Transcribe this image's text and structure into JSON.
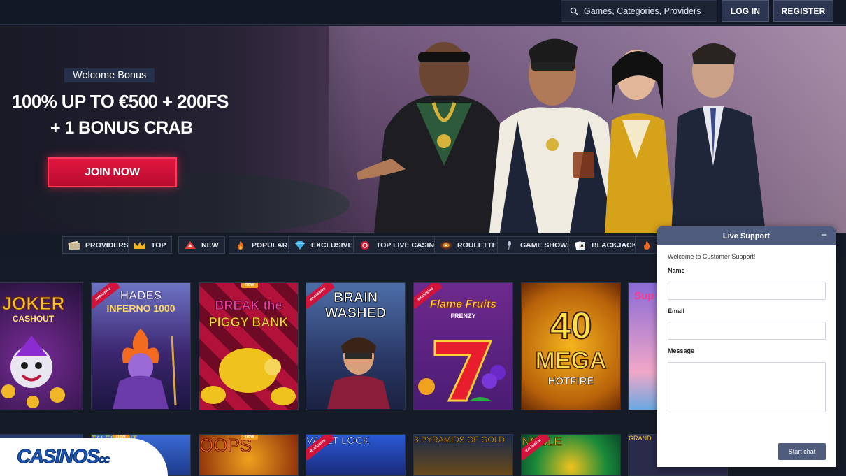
{
  "header": {
    "search_placeholder": "Games, Categories, Providers",
    "login_label": "LOG IN",
    "register_label": "REGISTER"
  },
  "hero": {
    "welcome_label": "Welcome Bonus",
    "promo_line1": "100% UP TO €500 + 200FS",
    "promo_line2": "+ 1 BONUS CRAB",
    "join_label": "JOIN NOW"
  },
  "categories": [
    {
      "label": "PROVIDERS",
      "icon": "cards-icon"
    },
    {
      "label": "TOP",
      "icon": "crown-icon"
    },
    {
      "label": "NEW",
      "icon": "new-badge-icon"
    },
    {
      "label": "POPULAR",
      "icon": "flame-icon"
    },
    {
      "label": "EXCLUSIVE",
      "icon": "diamond-icon"
    },
    {
      "label": "TOP LIVE CASINO",
      "icon": "chip-icon"
    },
    {
      "label": "ROULETTE",
      "icon": "roulette-icon"
    },
    {
      "label": "GAME SHOWS",
      "icon": "microphone-icon"
    },
    {
      "label": "BLACKJACK",
      "icon": "playing-cards-icon"
    }
  ],
  "games_row1": [
    {
      "title_a": "JOKER",
      "title_b": "CASHOUT",
      "badge": ""
    },
    {
      "title_a": "HADES",
      "title_b": "INFERNO 1000",
      "badge": "exclusive"
    },
    {
      "title_a": "BREAK the",
      "title_b": "PIGGY BANK",
      "badge": "new"
    },
    {
      "title_a": "BRAIN",
      "title_b": "WASHED",
      "badge": "exclusive"
    },
    {
      "title_a": "Flame Fruits",
      "title_b": "FRENZY",
      "badge": "exclusive"
    },
    {
      "title_a": "40",
      "title_b": "MEGA",
      "title_c": "HOTFIRE",
      "badge": ""
    },
    {
      "title_a": "Sup",
      "title_b": "",
      "badge": ""
    }
  ],
  "games_row2": [
    {
      "title": "",
      "badge": ""
    },
    {
      "title": "TALES & HIT",
      "badge": "new"
    },
    {
      "title": "OOPS",
      "badge": "new"
    },
    {
      "title": "VAULT LOCK",
      "badge": "exclusive"
    },
    {
      "title": "3 PYRAMIDS OF GOLD",
      "badge": ""
    },
    {
      "title": "NOBLE",
      "badge": "exclusive"
    },
    {
      "title": "GRAND",
      "badge": ""
    }
  ],
  "chat": {
    "title": "Live Support",
    "minimize": "−",
    "welcome": "Welcome to Customer Support!",
    "name_label": "Name",
    "email_label": "Email",
    "message_label": "Message",
    "start_label": "Start chat"
  },
  "logo": {
    "text": "CASINOS",
    "suffix": "cc"
  },
  "colors": {
    "accent_red": "#e3163f",
    "chat_header": "#4f5c7e",
    "background": "#161c27"
  }
}
